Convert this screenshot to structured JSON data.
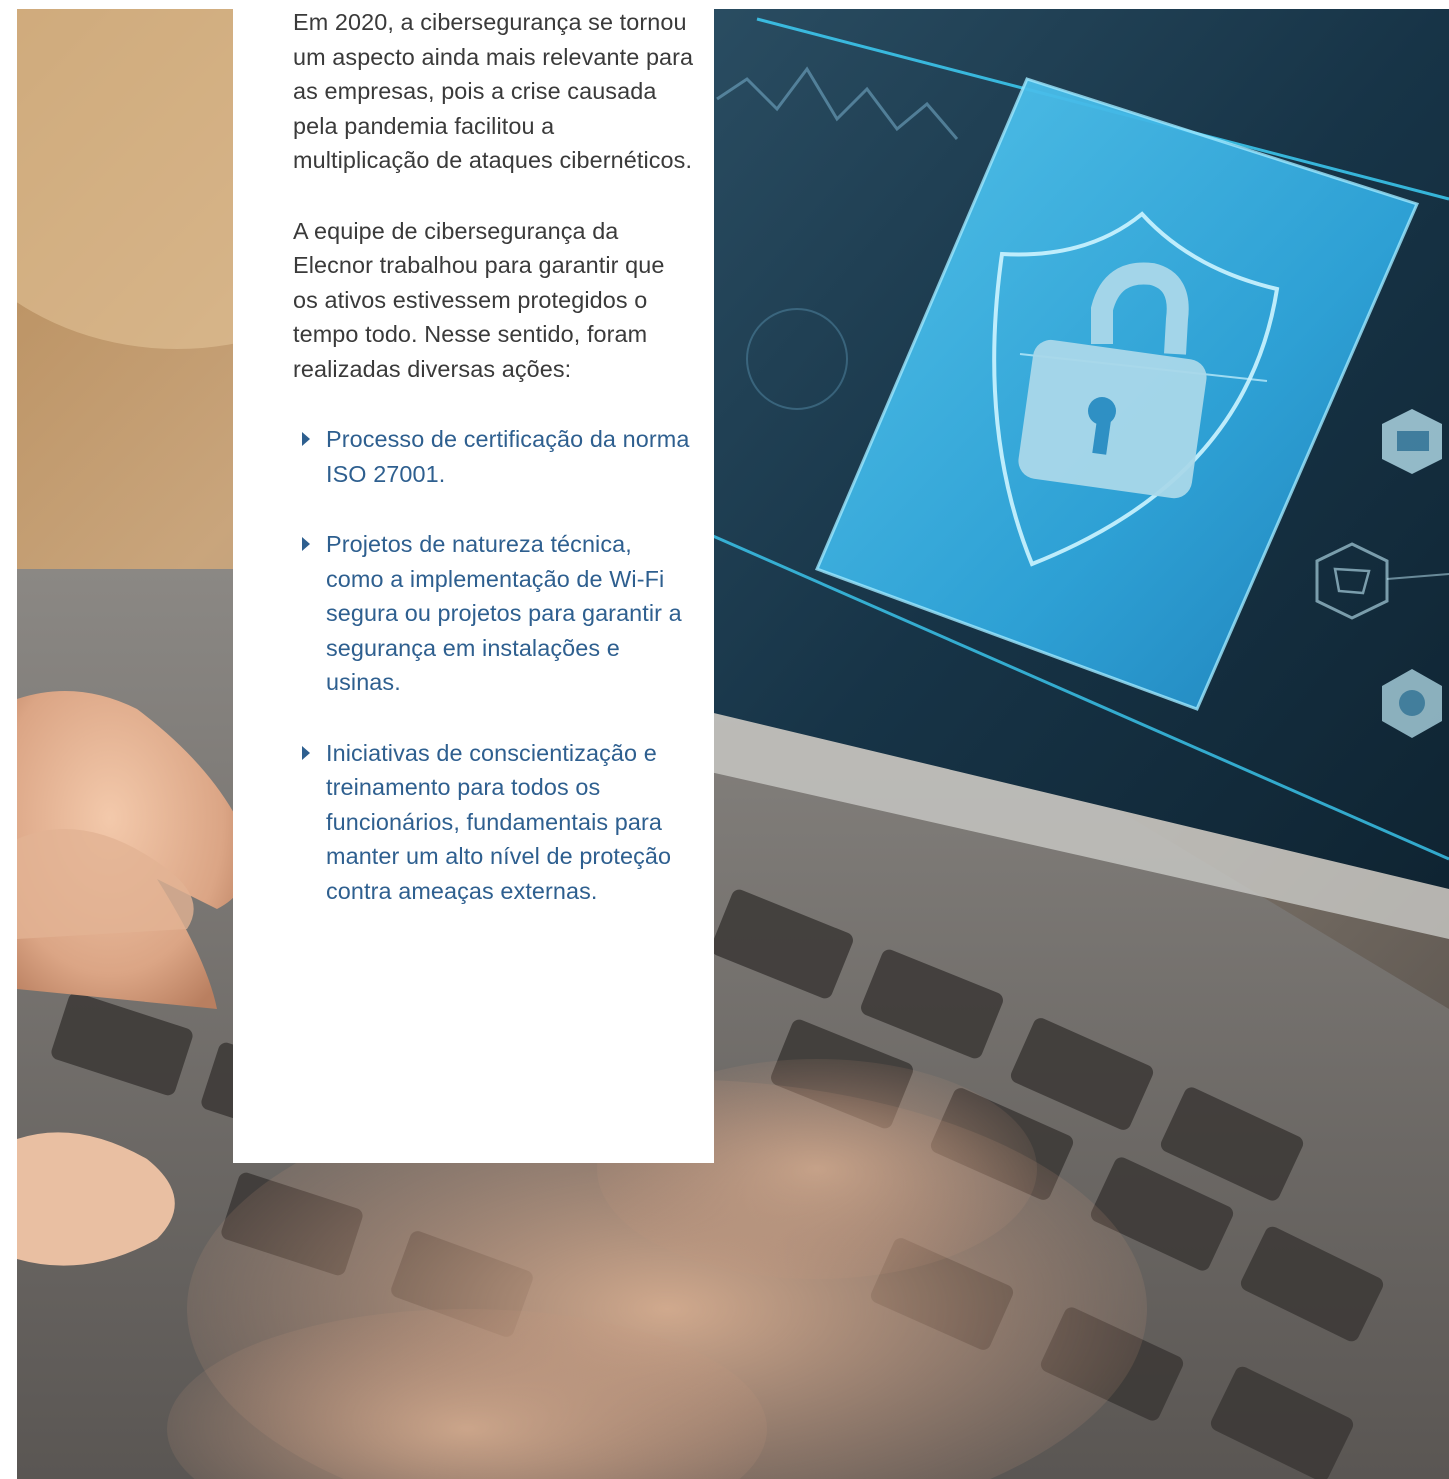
{
  "article": {
    "paragraphs": [
      "Em 2020, a cibersegurança se tornou um aspecto ainda mais relevante para as empresas, pois a crise causada pela pandemia facilitou a multiplicação de ataques cibernéticos.",
      "A equipe de cibersegurança da Elecnor trabalhou para garantir que os ativos estivessem protegidos o tempo todo. Nesse sentido, foram realizadas diversas ações:"
    ],
    "actions": [
      "Processo de certificação da norma ISO 27001.",
      "Projetos de natureza técnica, como a implementação de Wi-Fi segura ou projetos para garantir a segurança em instalações e usinas.",
      "Iniciativas de conscientização e treinamento para todos os funcionários, fundamentais para manter um alto nível de proteção contra ameaças externas."
    ]
  },
  "colors": {
    "body_text": "#3a3a3a",
    "bullet_text": "#2e5f8f",
    "screen_accent": "#2bb3e6"
  },
  "photo": {
    "icons": [
      "shield-icon",
      "padlock-icon",
      "envelope-icon",
      "cart-icon",
      "globe-icon"
    ]
  }
}
